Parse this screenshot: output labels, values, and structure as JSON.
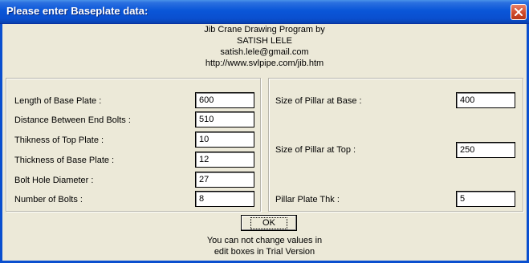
{
  "window": {
    "title": "Please enter Baseplate data:"
  },
  "header": {
    "line1": "Jib Crane Drawing Program by",
    "line2": "SATISH LELE",
    "line3": "satish.lele@gmail.com",
    "line4": "http://www.svlpipe.com/jib.htm"
  },
  "left_group": {
    "fields": [
      {
        "label": "Length of Base Plate :",
        "value": "600"
      },
      {
        "label": "Distance Between End Bolts :",
        "value": "510"
      },
      {
        "label": "Thikness of Top Plate :",
        "value": "10"
      },
      {
        "label": "Thickness of Base Plate :",
        "value": "12"
      },
      {
        "label": "Bolt Hole Diameter :",
        "value": "27"
      },
      {
        "label": "Number of Bolts :",
        "value": "8"
      }
    ]
  },
  "right_group": {
    "fields": [
      {
        "label": "Size of Pillar at Base :",
        "value": "400"
      },
      {
        "label": "Size of Pillar at Top :",
        "value": "250"
      },
      {
        "label": "Pillar Plate Thk :",
        "value": "5"
      }
    ]
  },
  "ok_button": {
    "label": "OK"
  },
  "footer": {
    "line1": "You can not change values in",
    "line2": "edit boxes in Trial Version"
  },
  "icons": {
    "close": "close-icon"
  },
  "colors": {
    "titlebar": "#0a4fcf",
    "dialog_bg": "#ece9d8",
    "close_button": "#d04a2a"
  }
}
